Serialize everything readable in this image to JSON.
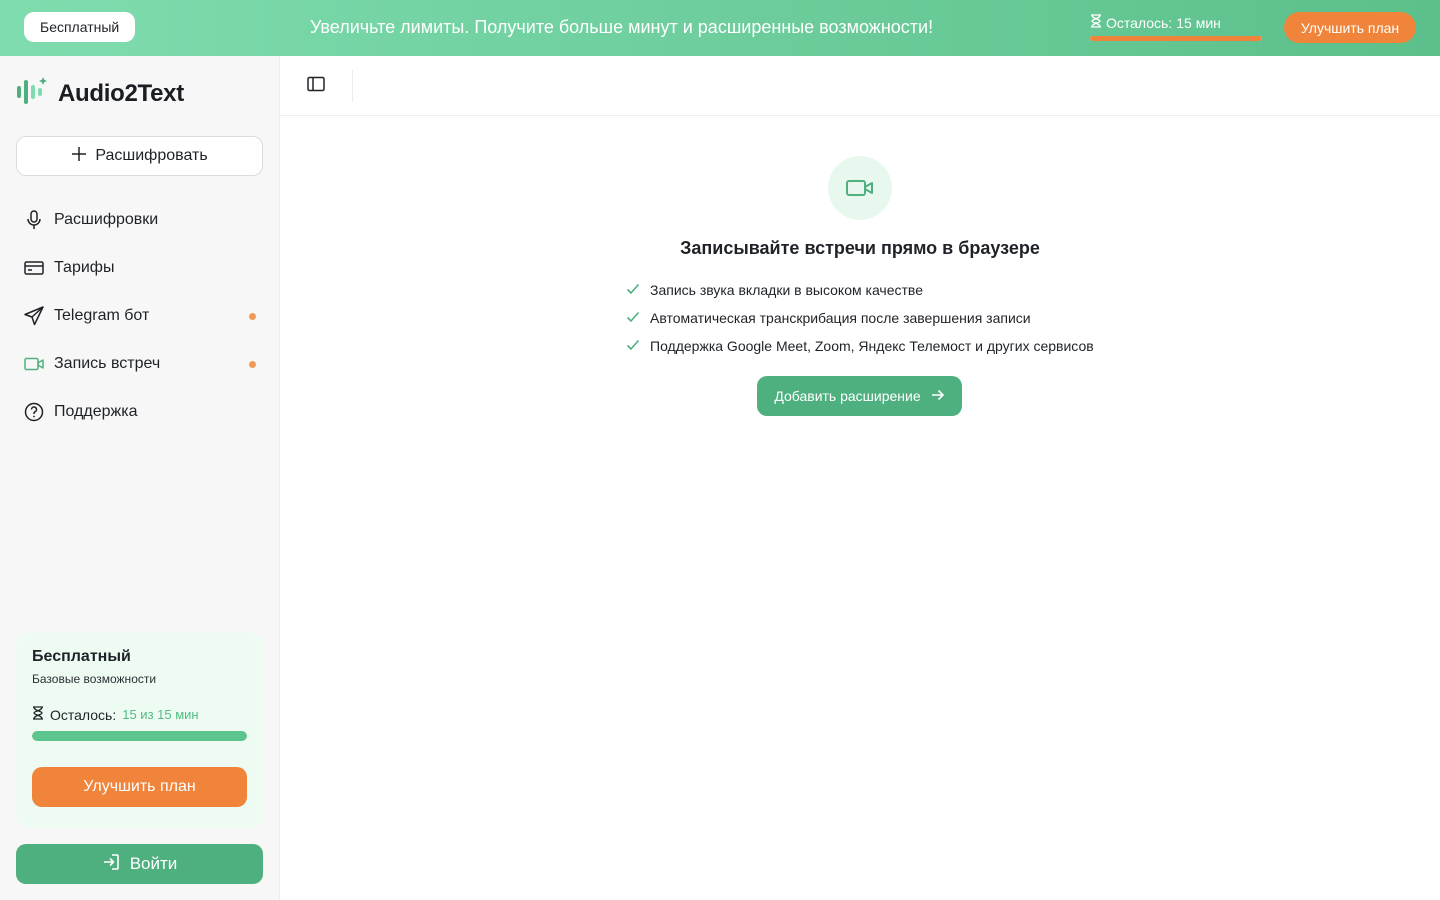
{
  "banner": {
    "plan_badge": "Бесплатный",
    "message": "Увеличьте лимиты. Получите больше минут и расширенные возможности!",
    "remaining_label": "Осталось:",
    "remaining_value": "15 мин",
    "remaining_fraction": 1.0,
    "upgrade_label": "Улучшить план"
  },
  "sidebar": {
    "brand": "Audio2Text",
    "new_label": "Расшифровать",
    "items": [
      {
        "label": "Расшифровки",
        "icon": "microphone-icon"
      },
      {
        "label": "Тарифы",
        "icon": "card-icon"
      },
      {
        "label": "Telegram бот",
        "icon": "send-icon",
        "dot": true
      },
      {
        "label": "Запись встреч",
        "icon": "video-camera-icon",
        "dot": true
      },
      {
        "label": "Поддержка",
        "icon": "help-circle-icon"
      }
    ],
    "plan_card": {
      "title": "Бесплатный",
      "subtitle": "Базовые возможности",
      "remaining_label": "Осталось:",
      "remaining_value": "15 из 15 мин",
      "remaining_fraction": 1.0,
      "upgrade_label": "Улучшить план"
    },
    "login_label": "Войти"
  },
  "main": {
    "feature_title": "Записывайте встречи прямо в браузере",
    "features": [
      "Запись звука вкладки в высоком качестве",
      "Автоматическая транскрибация после завершения записи",
      "Поддержка Google Meet, Zoom, Яндекс Телемост и других сервисов"
    ],
    "cta_label": "Добавить расширение"
  },
  "colors": {
    "brand_green": "#4fb07f",
    "accent_orange": "#f0843a",
    "light_green": "#eefbf3"
  }
}
